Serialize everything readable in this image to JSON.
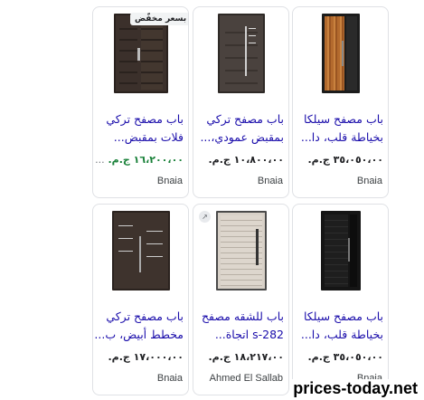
{
  "cards": [
    {
      "title_line1": "باب مصفح سيلكا",
      "title_line2": "بخياطة قلب، دا...",
      "price": "٣٥،٠٥٠،٠٠ ج.م.",
      "seller": "Bnaia"
    },
    {
      "title_line1": "باب مصفح تركي",
      "title_line2": "بمقبض عمودي،...",
      "price": "١٠،٨٠٠،٠٠ ج.م.",
      "seller": "Bnaia"
    },
    {
      "badge": "بسعر مخفّض",
      "title_line1": "باب مصفح تركي",
      "title_line2": "فلات بمقبض...",
      "price": "١٦،٢٠٠،٠٠ ج.م.",
      "price_more": "...",
      "seller": "Bnaia"
    },
    {
      "title_line1": "باب مصفح سيلكا",
      "title_line2": "بخياطة قلب، دا...",
      "price": "٣٥،٠٥٠،٠٠ ج.م.",
      "seller": "Bnaia"
    },
    {
      "lens_icon": "visual-search-icon",
      "title_line1": "باب للشقه مصفح",
      "title_line2": "s-282 اتجاة...",
      "price": "١٨،٢١٧،٠٠ ج.م.",
      "seller": "Ahmed El Sallab"
    },
    {
      "title_line1": "باب مصفح تركي",
      "title_line2": "مخطط أبيض، ب...",
      "price": "١٧،٠٠٠،٠٠ ج.م.",
      "seller": "Bnaia"
    }
  ],
  "watermark": "prices-today.net"
}
